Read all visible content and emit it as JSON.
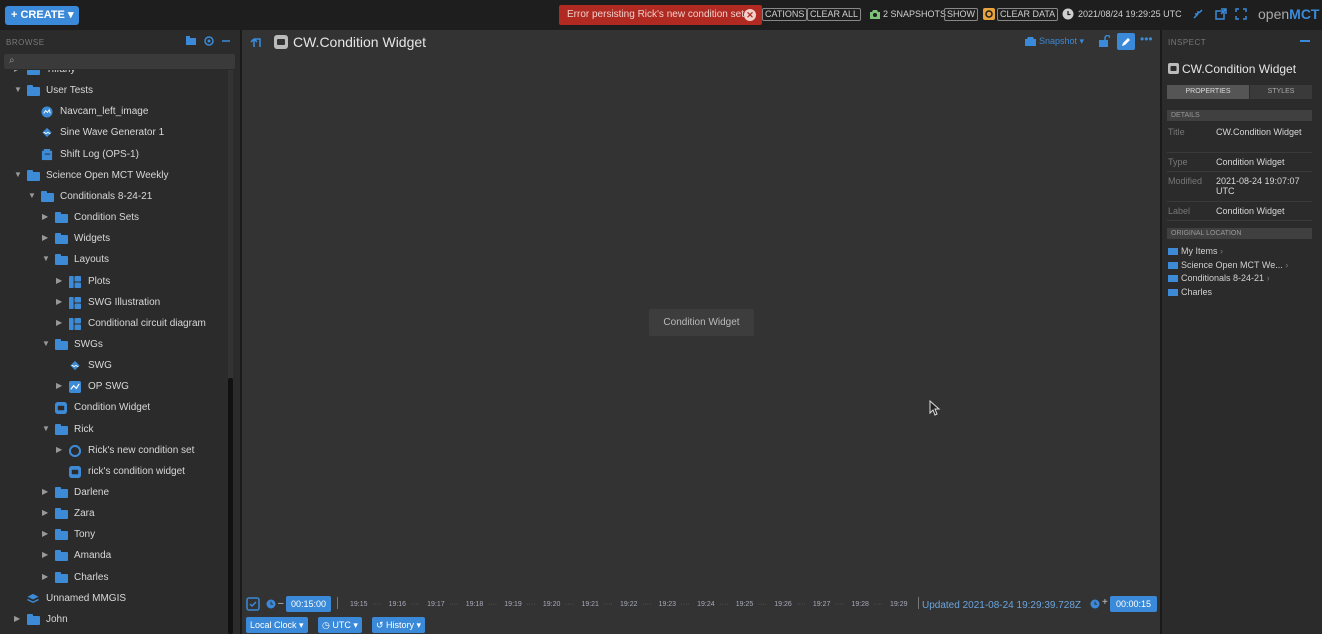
{
  "topbar": {
    "create_label": "+ CREATE ▾",
    "error_message": "Error persisting Rick's new condition set",
    "notifications_label": "CATIONS",
    "clear_all_label": "CLEAR ALL",
    "snapshots_label": "2 SNAPSHOTS",
    "show_label": "SHOW",
    "clear_data_label": "CLEAR DATA",
    "clock_text": "2021/08/24 19:29:25 UTC",
    "logo_prefix": "open",
    "logo_suffix": "MCT"
  },
  "browse": {
    "label": "BROWSE",
    "items": [
      {
        "label": "Tiffany",
        "indent": 1,
        "arrow": "right",
        "icon": "folder"
      },
      {
        "label": "User Tests",
        "indent": 1,
        "arrow": "down",
        "icon": "folder"
      },
      {
        "label": "Navcam_left_image",
        "indent": 2,
        "arrow": "",
        "icon": "imagery"
      },
      {
        "label": "Sine Wave Generator 1",
        "indent": 2,
        "arrow": "",
        "icon": "generator"
      },
      {
        "label": "Shift Log (OPS-1)",
        "indent": 2,
        "arrow": "",
        "icon": "notebook"
      },
      {
        "label": "Science Open MCT Weekly",
        "indent": 1,
        "arrow": "down",
        "icon": "folder"
      },
      {
        "label": "Conditionals 8-24-21",
        "indent": 2,
        "arrow": "down",
        "icon": "folder"
      },
      {
        "label": "Condition Sets",
        "indent": 3,
        "arrow": "right",
        "icon": "folder"
      },
      {
        "label": "Widgets",
        "indent": 3,
        "arrow": "right",
        "icon": "folder"
      },
      {
        "label": "Layouts",
        "indent": 3,
        "arrow": "down",
        "icon": "folder"
      },
      {
        "label": "Plots",
        "indent": 4,
        "arrow": "right",
        "icon": "layout"
      },
      {
        "label": "SWG Illustration",
        "indent": 4,
        "arrow": "right",
        "icon": "layout"
      },
      {
        "label": "Conditional circuit diagram",
        "indent": 4,
        "arrow": "right",
        "icon": "layout"
      },
      {
        "label": "SWGs",
        "indent": 3,
        "arrow": "down",
        "icon": "folder"
      },
      {
        "label": "SWG",
        "indent": 4,
        "arrow": "",
        "icon": "generator"
      },
      {
        "label": "OP SWG",
        "indent": 4,
        "arrow": "right",
        "icon": "plot"
      },
      {
        "label": "Condition Widget",
        "indent": 3,
        "arrow": "",
        "icon": "condition-widget"
      },
      {
        "label": "Rick",
        "indent": 3,
        "arrow": "down",
        "icon": "folder"
      },
      {
        "label": "Rick's new condition set",
        "indent": 4,
        "arrow": "right",
        "icon": "condition-set"
      },
      {
        "label": "rick's condition widget",
        "indent": 4,
        "arrow": "",
        "icon": "condition-widget"
      },
      {
        "label": "Darlene",
        "indent": 3,
        "arrow": "right",
        "icon": "folder"
      },
      {
        "label": "Zara",
        "indent": 3,
        "arrow": "right",
        "icon": "folder"
      },
      {
        "label": "Tony",
        "indent": 3,
        "arrow": "right",
        "icon": "folder"
      },
      {
        "label": "Amanda",
        "indent": 3,
        "arrow": "right",
        "icon": "folder"
      },
      {
        "label": "Charles",
        "indent": 3,
        "arrow": "right",
        "icon": "folder"
      },
      {
        "label": "Unnamed MMGIS",
        "indent": 1,
        "arrow": "",
        "icon": "mmgis"
      },
      {
        "label": "John",
        "indent": 1,
        "arrow": "right",
        "icon": "folder"
      }
    ]
  },
  "main": {
    "title": "CW.Condition Widget",
    "snapshot_label": "Snapshot ▾",
    "center_label": "Condition Widget"
  },
  "time": {
    "start_offset": "00:15:00",
    "end_offset": "00:00:15",
    "ticks": [
      "19:15",
      "19:16",
      "19:17",
      "19:18",
      "19:19",
      "19:20",
      "19:21",
      "19:22",
      "19:23",
      "19:24",
      "19:25",
      "19:26",
      "19:27",
      "19:28",
      "19:29"
    ],
    "updated_text": "Updated  2021-08-24 19:29:39.728Z",
    "local_clock_label": "Local Clock ▾",
    "utc_label": "UTC ▾",
    "history_label": "History ▾"
  },
  "inspector": {
    "label": "INSPECT",
    "title": "CW.Condition Widget",
    "tab_properties": "PROPERTIES",
    "tab_styles": "STYLES",
    "details_header": "DETAILS",
    "title_key": "Title",
    "title_val": "CW.Condition Widget",
    "type_key": "Type",
    "type_val": "Condition Widget",
    "modified_key": "Modified",
    "modified_val": "2021-08-24 19:07:07 UTC",
    "label_key": "Label",
    "label_val": "Condition Widget",
    "location_header": "ORIGINAL LOCATION",
    "location": [
      "My Items",
      "Science Open MCT We...",
      "Conditionals 8-24-21",
      "Charles"
    ]
  },
  "colors": {
    "accent": "#3a8ad9",
    "error": "#b02a22",
    "background": "#2b2b2b",
    "main_background": "#333333"
  }
}
